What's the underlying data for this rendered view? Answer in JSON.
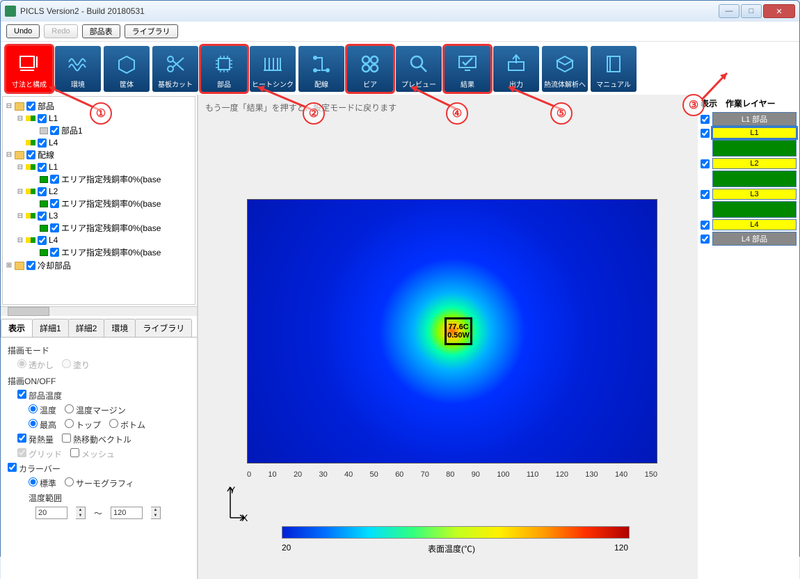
{
  "window": {
    "title": "PICLS Version2 - Build 20180531"
  },
  "mini": {
    "undo": "Undo",
    "redo": "Redo",
    "parts": "部品表",
    "library": "ライブラリ"
  },
  "tools": {
    "items": [
      {
        "label": "寸法と構成",
        "hl": true
      },
      {
        "label": "環境"
      },
      {
        "label": "筐体"
      },
      {
        "label": "基板カット"
      },
      {
        "label": "部品",
        "hl": true
      },
      {
        "label": "ヒートシンク"
      },
      {
        "label": "配線"
      },
      {
        "label": "ビア",
        "hl": true
      },
      {
        "label": "プレビュー"
      },
      {
        "label": "結果",
        "hl": true
      },
      {
        "label": "出力"
      },
      {
        "label": "熱流体解析へ"
      },
      {
        "label": "マニュアル"
      }
    ]
  },
  "hint": "もう一度「結果」を押すと、設定モードに戻ります",
  "tree": {
    "root_parts": "部品",
    "l1": "L1",
    "parts1": "部品1",
    "l4": "L4",
    "root_wiring": "配線",
    "w_l1": "L1",
    "w_l2": "L2",
    "w_l3": "L3",
    "w_l4": "L4",
    "area": "エリア指定残銅率0%(base",
    "root_cooling": "冷却部品"
  },
  "tabs": {
    "t1": "表示",
    "t2": "詳細1",
    "t3": "詳細2",
    "t4": "環境",
    "t5": "ライブラリ"
  },
  "panel": {
    "draw_mode": "描画モード",
    "transparent": "透かし",
    "fill": "塗り",
    "draw_onoff": "描画ON/OFF",
    "parts_temp": "部品温度",
    "temp": "温度",
    "temp_margin": "温度マージン",
    "max": "最高",
    "top": "トップ",
    "bottom": "ボトム",
    "heat": "発熱量",
    "heat_vec": "熱移動ベクトル",
    "grid": "グリッド",
    "mesh": "メッシュ",
    "colorbar": "カラーバー",
    "standard": "標準",
    "thermo": "サーモグラフィ",
    "temp_range": "温度範囲",
    "range_lo": "20",
    "range_hi": "120",
    "tilde": "～"
  },
  "chart_data": {
    "type": "heatmap",
    "title": "",
    "xlabel": "X",
    "ylabel": "Y",
    "xlim": [
      0,
      150
    ],
    "ylim": [
      0,
      100
    ],
    "x_ticks": [
      0,
      10,
      20,
      30,
      40,
      50,
      60,
      70,
      80,
      90,
      100,
      110,
      120,
      130,
      140,
      150
    ],
    "hotspot": {
      "x": 75,
      "y": 50,
      "temp_c": 77.6,
      "power_w": 0.5
    },
    "colorbar": {
      "label": "表面温度(℃)",
      "min": 20,
      "max": 120
    }
  },
  "layers": {
    "hdr_show": "表示",
    "hdr_work": "作業レイヤー",
    "items": [
      {
        "label": "L1 部品",
        "style": "gray"
      },
      {
        "label": "L1",
        "style": "yellow",
        "sel": true
      },
      {
        "label": "",
        "style": "green"
      },
      {
        "label": "L2",
        "style": "yellow"
      },
      {
        "label": "",
        "style": "green"
      },
      {
        "label": "L3",
        "style": "yellow"
      },
      {
        "label": "",
        "style": "green"
      },
      {
        "label": "L4",
        "style": "yellow"
      },
      {
        "label": "L4 部品",
        "style": "gray"
      }
    ]
  },
  "chip": {
    "line1": "77.6C",
    "line2": "0.50W"
  },
  "callouts": {
    "c1": "①",
    "c2": "②",
    "c3": "③",
    "c4": "④",
    "c5": "⑤"
  }
}
